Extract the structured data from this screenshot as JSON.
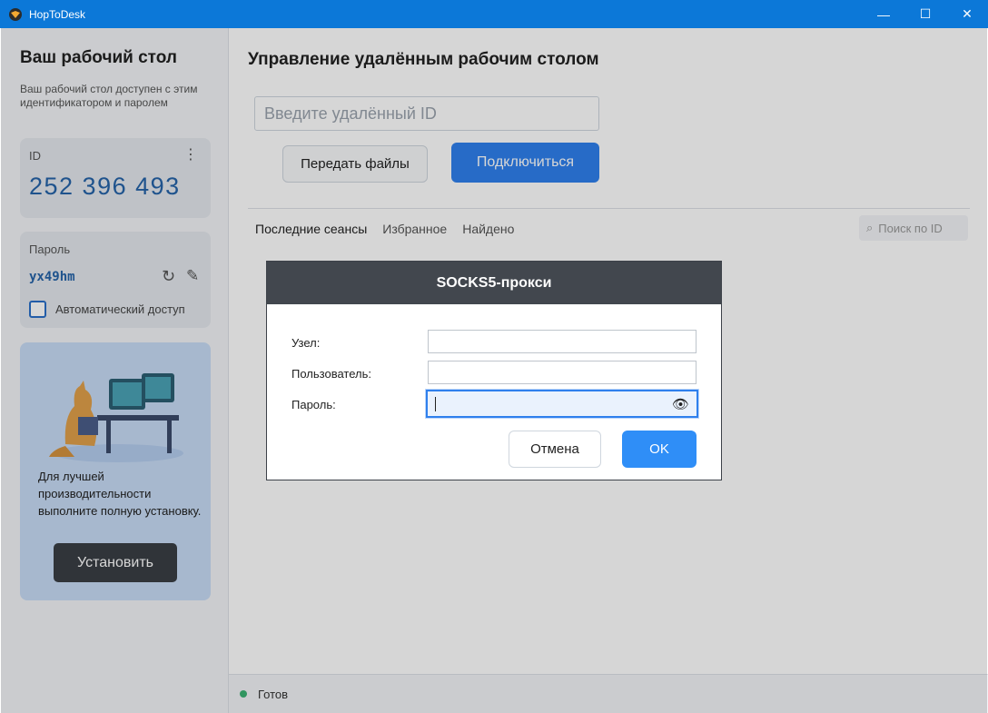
{
  "window": {
    "title": "HopToDesk",
    "minimize": "—",
    "maximize": "☐",
    "close": "✕"
  },
  "sidebar": {
    "title": "Ваш рабочий стол",
    "description": "Ваш рабочий стол доступен с этим идентификатором и паролем",
    "id_label": "ID",
    "id_value": "252 396 493",
    "menu_icon": "⋮",
    "password_label": "Пароль",
    "password_value": "yx49hm",
    "refresh_icon": "↻",
    "edit_icon": "✎",
    "auto_access_label": "Автоматический доступ",
    "promo_text": "Для лучшей производительности выполните полную установку.",
    "install_label": "Установить"
  },
  "main": {
    "title": "Управление удалённым рабочим столом",
    "remote_id_placeholder": "Введите удалённый ID",
    "transfer_files_label": "Передать файлы",
    "connect_label": "Подключиться",
    "tabs": [
      "Последние сеансы",
      "Избранное",
      "Найдено"
    ],
    "search_placeholder": "Поиск по ID",
    "search_icon": "⌕"
  },
  "status": {
    "text": "Готов",
    "color": "#3bb273"
  },
  "dialog": {
    "title": "SOCKS5-прокси",
    "host_label": "Узел:",
    "user_label": "Пользователь:",
    "password_label": "Пароль:",
    "host_value": "",
    "user_value": "",
    "password_value": "",
    "eye_icon": "👁",
    "cancel_label": "Отмена",
    "ok_label": "OK"
  },
  "colors": {
    "titlebar": "#0c78d8",
    "accent": "#2f80ed",
    "dialog_header": "#42474e"
  }
}
